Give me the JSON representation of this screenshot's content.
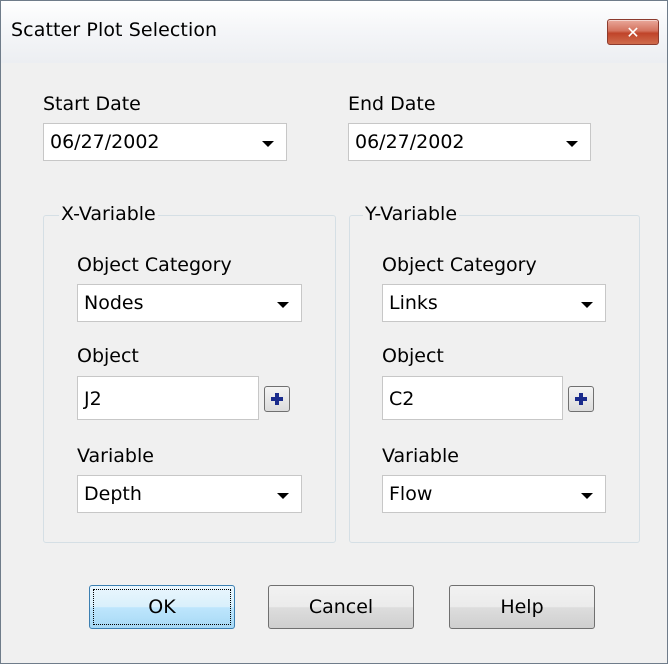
{
  "window": {
    "title": "Scatter Plot Selection",
    "close_icon": "close-icon"
  },
  "dates": {
    "start_label": "Start Date",
    "start_value": "06/27/2002",
    "end_label": "End Date",
    "end_value": "06/27/2002"
  },
  "x_variable": {
    "legend": "X-Variable",
    "category_label": "Object Category",
    "category_value": "Nodes",
    "object_label": "Object",
    "object_value": "J2",
    "variable_label": "Variable",
    "variable_value": "Depth"
  },
  "y_variable": {
    "legend": "Y-Variable",
    "category_label": "Object Category",
    "category_value": "Links",
    "object_label": "Object",
    "object_value": "C2",
    "variable_label": "Variable",
    "variable_value": "Flow"
  },
  "buttons": {
    "ok": "OK",
    "cancel": "Cancel",
    "help": "Help"
  },
  "colors": {
    "dialog_background": "#f0f0f0",
    "close_button": "#c7432a",
    "default_button": "#bee6fd",
    "plus_icon": "#1a2b8c"
  }
}
